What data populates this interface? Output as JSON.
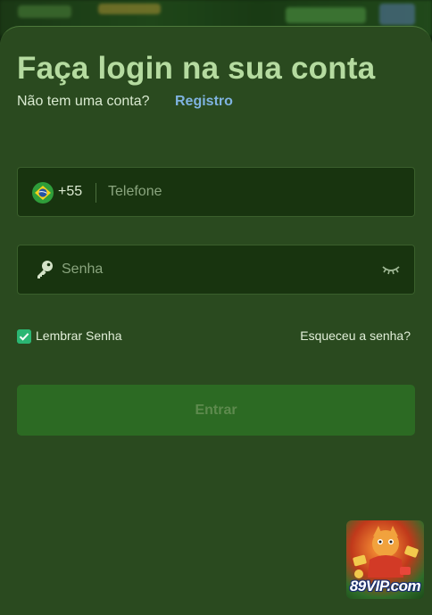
{
  "login": {
    "title": "Faça login na sua conta",
    "no_account_text": "Não tem uma conta?",
    "register_link": "Registro",
    "phone": {
      "country_code": "+55",
      "placeholder": "Telefone",
      "value": "",
      "flag_icon": "brazil-flag-icon"
    },
    "password": {
      "placeholder": "Senha",
      "value": "",
      "lead_icon": "key-icon",
      "toggle_icon": "eye-closed-icon"
    },
    "remember": {
      "label": "Lembrar Senha",
      "checked": true
    },
    "forgot_link": "Esqueceu a senha?",
    "submit_label": "Entrar"
  },
  "promo": {
    "logo_text": "89VIP.com"
  },
  "colors": {
    "sheet_background": "#2a4a1f",
    "field_background": "#18340f",
    "title": "#b5dba0",
    "link_blue": "#7fb3e0",
    "checkbox_green": "#2bb673",
    "button_background": "#2c6a23"
  }
}
